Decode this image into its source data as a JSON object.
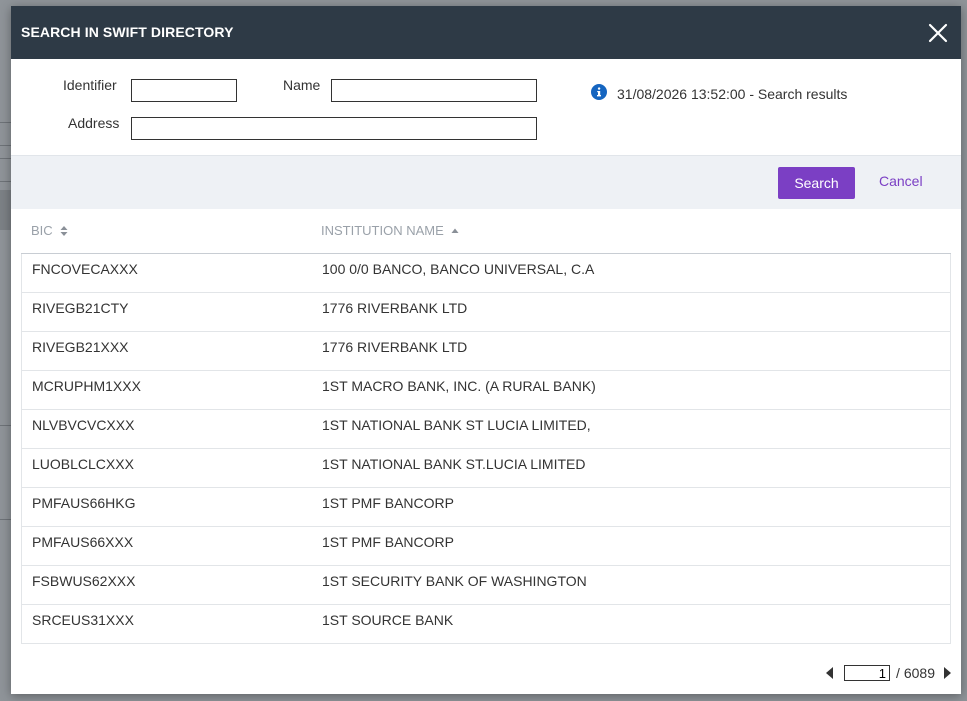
{
  "dialog": {
    "title": "SEARCH IN SWIFT DIRECTORY"
  },
  "form": {
    "identifier_label": "Identifier",
    "identifier_value": "",
    "name_label": "Name",
    "name_value": "",
    "address_label": "Address",
    "address_value": ""
  },
  "status": {
    "icon": "info-icon",
    "text": "31/08/2026 13:52:00 - Search results"
  },
  "actions": {
    "search_label": "Search",
    "cancel_label": "Cancel",
    "accent_color": "#7b3fc4"
  },
  "table": {
    "columns": [
      {
        "label": "BIC",
        "sort": "none"
      },
      {
        "label": "INSTITUTION NAME",
        "sort": "ascending"
      }
    ],
    "rows": [
      {
        "bic": "FNCOVECAXXX",
        "name": "100 0/0 BANCO, BANCO UNIVERSAL, C.A"
      },
      {
        "bic": "RIVEGB21CTY",
        "name": "1776 RIVERBANK LTD"
      },
      {
        "bic": "RIVEGB21XXX",
        "name": "1776 RIVERBANK LTD"
      },
      {
        "bic": "MCRUPHM1XXX",
        "name": "1ST MACRO BANK, INC. (A RURAL BANK)"
      },
      {
        "bic": "NLVBVCVCXXX",
        "name": "1ST NATIONAL BANK ST LUCIA LIMITED,"
      },
      {
        "bic": "LUOBLCLCXXX",
        "name": "1ST NATIONAL BANK ST.LUCIA LIMITED"
      },
      {
        "bic": "PMFAUS66HKG",
        "name": "1ST PMF BANCORP"
      },
      {
        "bic": "PMFAUS66XXX",
        "name": "1ST PMF BANCORP"
      },
      {
        "bic": "FSBWUS62XXX",
        "name": "1ST SECURITY BANK OF WASHINGTON"
      },
      {
        "bic": "SRCEUS31XXX",
        "name": "1ST SOURCE BANK"
      }
    ]
  },
  "pagination": {
    "current_page": "1",
    "separator": "/",
    "total_pages": "6089"
  },
  "colors": {
    "header_bg": "#2e3a46",
    "action_bar_bg": "#eef1f5",
    "info_icon": "#1565c0",
    "overlay": "#8f9499"
  }
}
